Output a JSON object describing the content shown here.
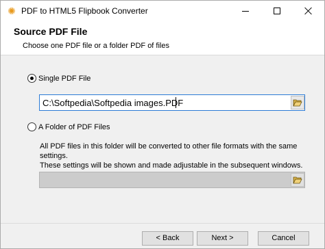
{
  "titlebar": {
    "title": "PDF to HTML5 Flipbook Converter",
    "icon": "sun-flower-icon"
  },
  "header": {
    "title": "Source PDF File",
    "subtitle": "Choose one PDF file or a folder PDF of files"
  },
  "options": {
    "single": {
      "label": "Single PDF File",
      "selected": true
    },
    "folder": {
      "label": "A Folder of PDF Files",
      "selected": false
    }
  },
  "single_path": {
    "value": "C:\\Softpedia\\Softpedia images.PDF"
  },
  "folder_description": {
    "line1": "All PDF files in this folder will be converted to other file formats with the same settings.",
    "line2": "These settings will be shown and made adjustable in the subsequent windows."
  },
  "folder_path": {
    "value": ""
  },
  "buttons": {
    "back": "< Back",
    "next": "Next >",
    "cancel": "Cancel"
  }
}
